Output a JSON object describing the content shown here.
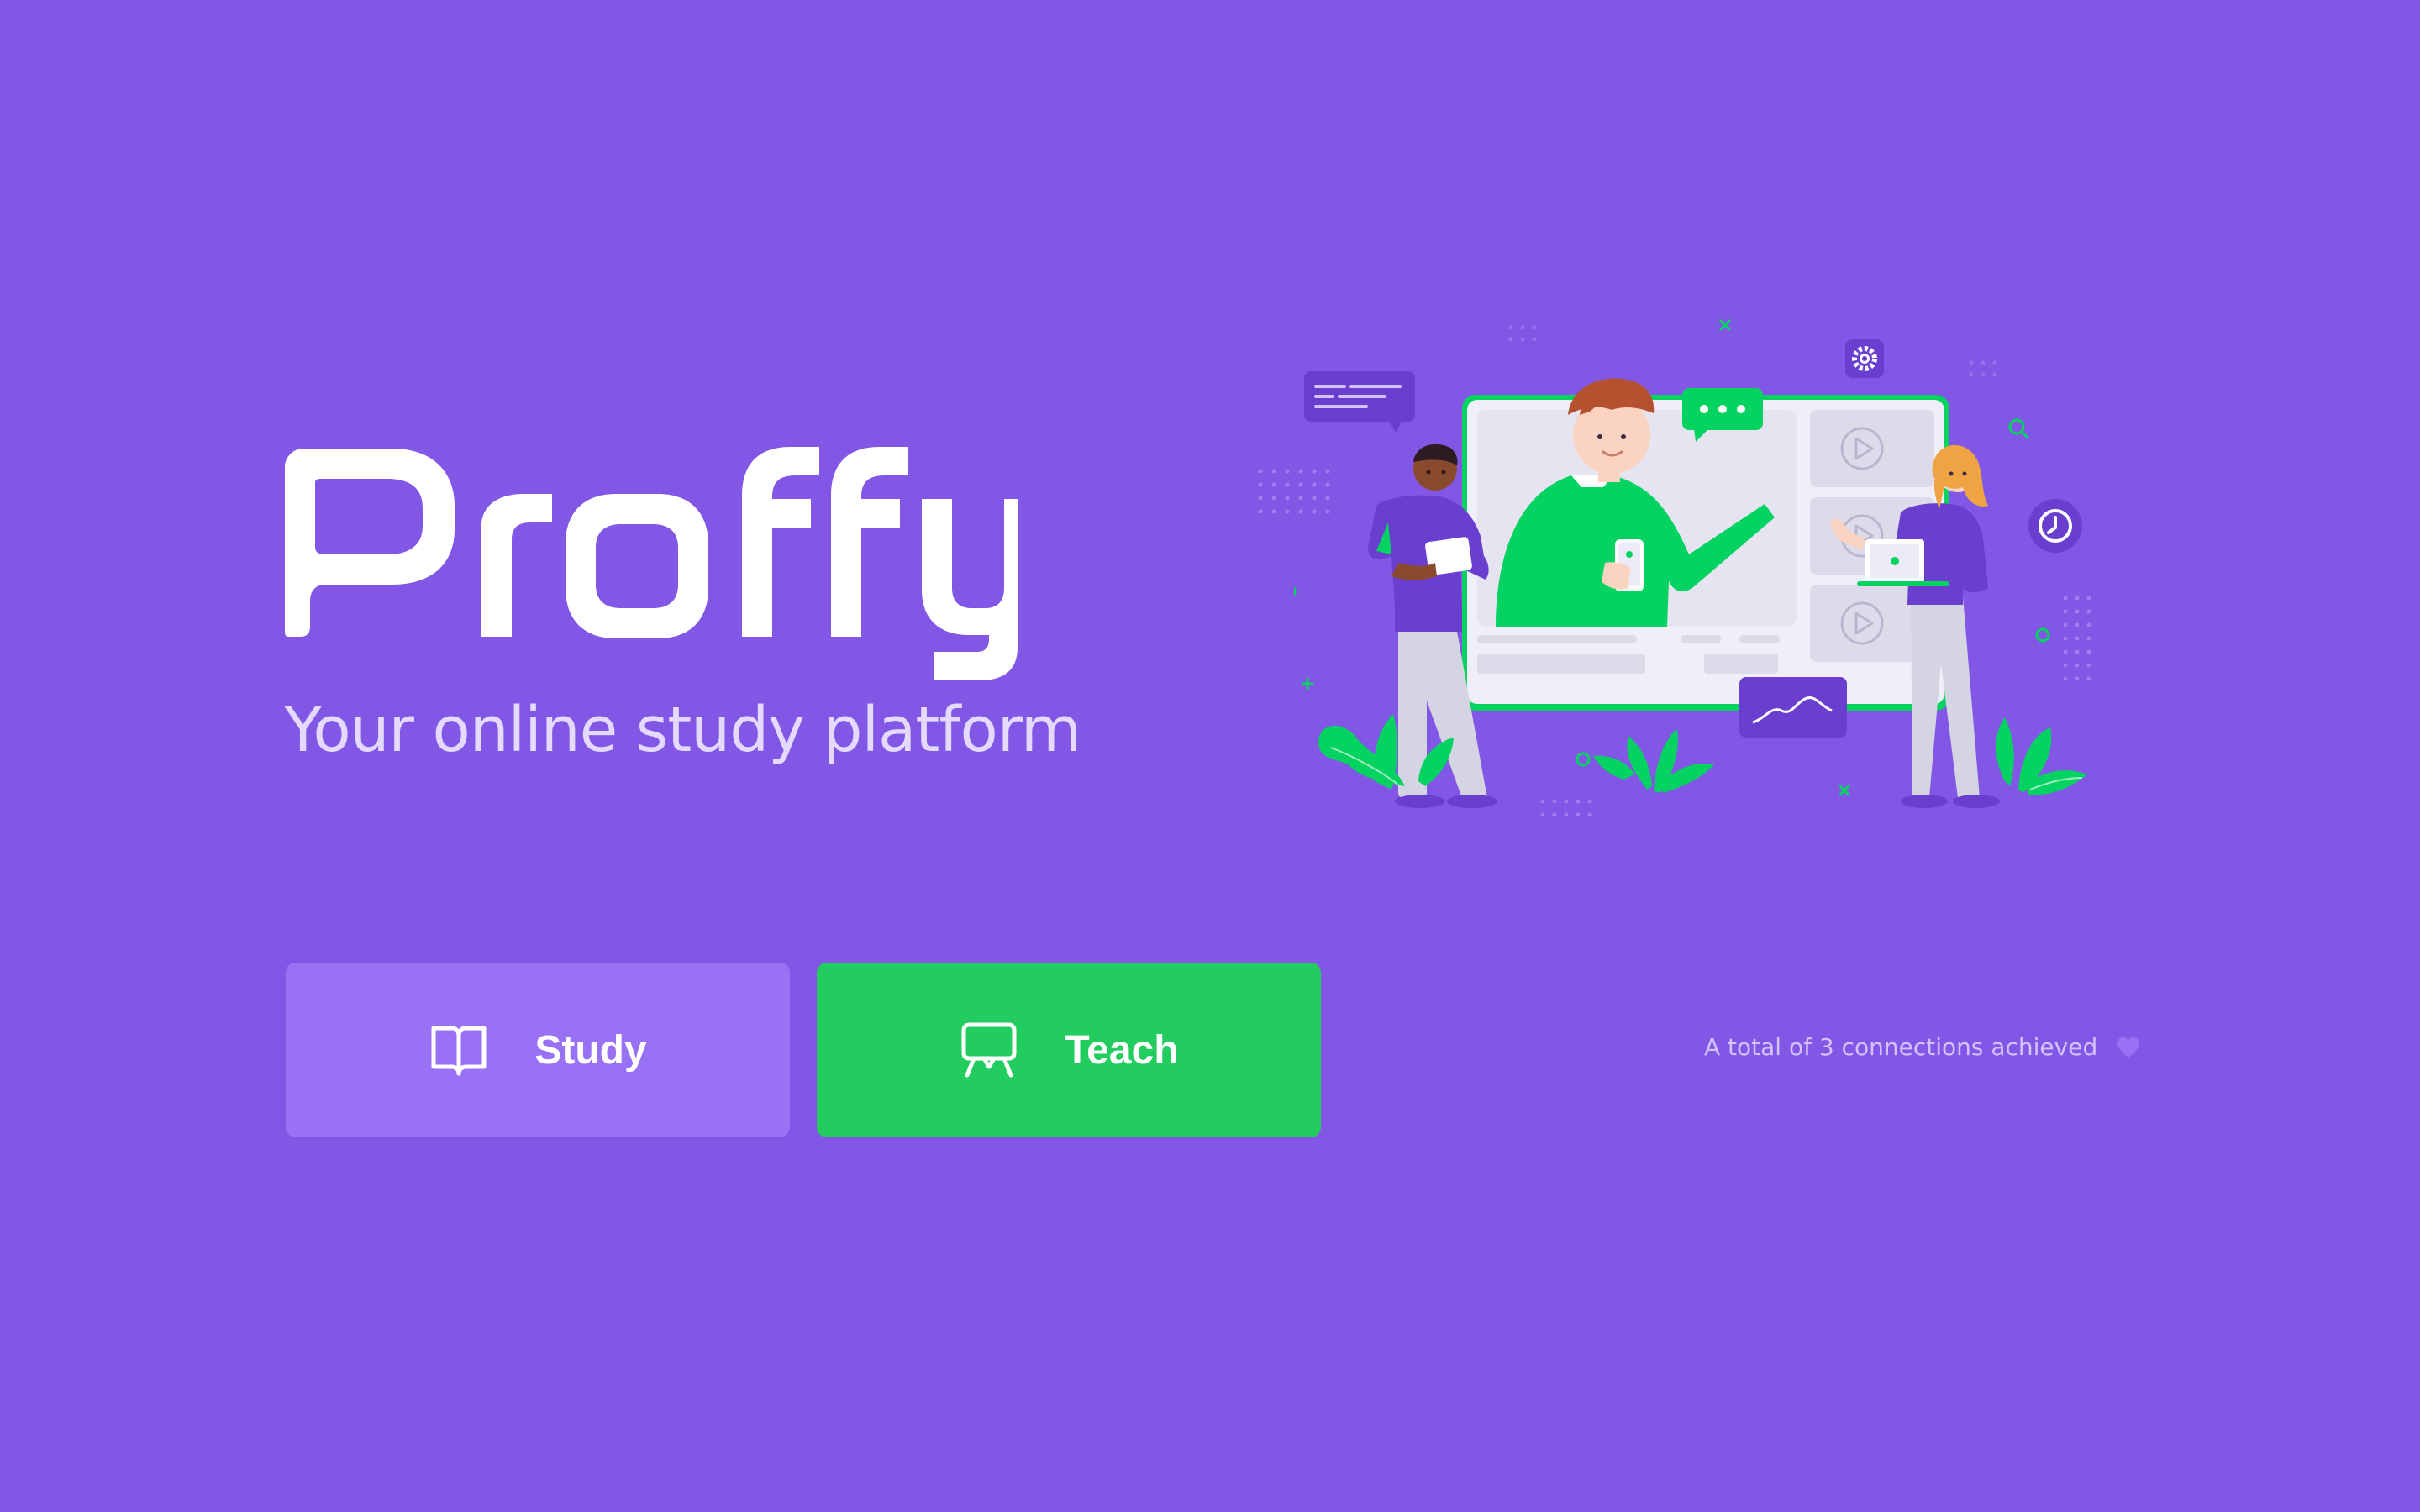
{
  "brand": {
    "name": "Proffy",
    "tagline": "Your online study platform"
  },
  "actions": {
    "study_label": "Study",
    "teach_label": "Teach"
  },
  "stats": {
    "connections_text": "A total of 3 connections achieved"
  },
  "icons": {
    "study": "open-book-icon",
    "teach": "presentation-board-icon",
    "heart": "heart-icon"
  },
  "colors": {
    "background": "#8257E5",
    "study_button": "#9871F5",
    "teach_button": "#22CC5E",
    "accent_green": "#04D361",
    "tagline": "#E4D9FF"
  }
}
